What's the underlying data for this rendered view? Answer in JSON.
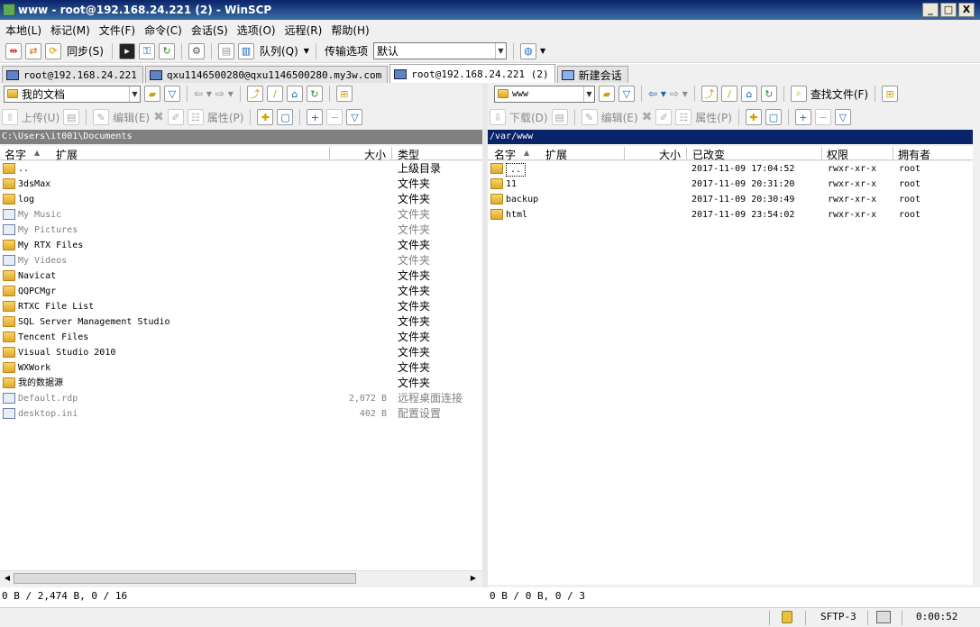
{
  "window": {
    "title": "www - root@192.168.24.221 (2) - WinSCP",
    "minimize": "_",
    "maximize": "□",
    "close": "X"
  },
  "menu": [
    "本地(L)",
    "标记(M)",
    "文件(F)",
    "命令(C)",
    "会话(S)",
    "选项(O)",
    "远程(R)",
    "帮助(H)"
  ],
  "toolbar": {
    "sync_label": "同步(S)",
    "queue_label": "队列(Q)",
    "transfer_label": "传输选项",
    "transfer_value": "默认"
  },
  "tabs": [
    {
      "label": "root@192.168.24.221"
    },
    {
      "label": "qxu1146500280@qxu1146500280.my3w.com"
    },
    {
      "label": "root@192.168.24.221 (2)"
    },
    {
      "label": "新建会话"
    }
  ],
  "left": {
    "location": "我的文档",
    "actions": {
      "upload": "上传(U)",
      "edit": "编辑(E)",
      "properties": "属性(P)"
    },
    "path": "C:\\Users\\it001\\Documents",
    "headers": {
      "name": "名字",
      "ext": "扩展",
      "size": "大小",
      "type": "类型"
    },
    "files": [
      {
        "name": "..",
        "size": "",
        "type": "上级目录",
        "kind": "up",
        "dim": false
      },
      {
        "name": "3dsMax",
        "size": "",
        "type": "文件夹",
        "kind": "folder",
        "dim": false
      },
      {
        "name": "log",
        "size": "",
        "type": "文件夹",
        "kind": "folder",
        "dim": false
      },
      {
        "name": "My Music",
        "size": "",
        "type": "文件夹",
        "kind": "special",
        "dim": true
      },
      {
        "name": "My Pictures",
        "size": "",
        "type": "文件夹",
        "kind": "special",
        "dim": true
      },
      {
        "name": "My RTX Files",
        "size": "",
        "type": "文件夹",
        "kind": "folder",
        "dim": false
      },
      {
        "name": "My Videos",
        "size": "",
        "type": "文件夹",
        "kind": "special",
        "dim": true
      },
      {
        "name": "Navicat",
        "size": "",
        "type": "文件夹",
        "kind": "folder",
        "dim": false
      },
      {
        "name": "QQPCMgr",
        "size": "",
        "type": "文件夹",
        "kind": "folder",
        "dim": false
      },
      {
        "name": "RTXC File List",
        "size": "",
        "type": "文件夹",
        "kind": "folder",
        "dim": false
      },
      {
        "name": "SQL Server Management Studio",
        "size": "",
        "type": "文件夹",
        "kind": "folder",
        "dim": false
      },
      {
        "name": "Tencent Files",
        "size": "",
        "type": "文件夹",
        "kind": "folder",
        "dim": false
      },
      {
        "name": "Visual Studio 2010",
        "size": "",
        "type": "文件夹",
        "kind": "folder",
        "dim": false
      },
      {
        "name": "WXWork",
        "size": "",
        "type": "文件夹",
        "kind": "folder",
        "dim": false
      },
      {
        "name": "我的数据源",
        "size": "",
        "type": "文件夹",
        "kind": "folder",
        "dim": false
      },
      {
        "name": "Default.rdp",
        "size": "2,072 B",
        "type": "远程桌面连接",
        "kind": "file",
        "dim": true
      },
      {
        "name": "desktop.ini",
        "size": "402 B",
        "type": "配置设置",
        "kind": "file",
        "dim": true
      }
    ],
    "status": "0 B / 2,474 B,  0 / 16"
  },
  "right": {
    "location": "www",
    "actions": {
      "download": "下载(D)",
      "edit": "编辑(E)",
      "properties": "属性(P)",
      "find": "查找文件(F)"
    },
    "path": "/var/www",
    "headers": {
      "name": "名字",
      "ext": "扩展",
      "size": "大小",
      "changed": "已改变",
      "rights": "权限",
      "owner": "拥有者"
    },
    "files": [
      {
        "name": "..",
        "changed": "2017-11-09 17:04:52",
        "rights": "rwxr-xr-x",
        "owner": "root",
        "kind": "up"
      },
      {
        "name": "11",
        "changed": "2017-11-09 20:31:20",
        "rights": "rwxr-xr-x",
        "owner": "root",
        "kind": "folder"
      },
      {
        "name": "backup",
        "changed": "2017-11-09 20:30:49",
        "rights": "rwxr-xr-x",
        "owner": "root",
        "kind": "folder"
      },
      {
        "name": "html",
        "changed": "2017-11-09 23:54:02",
        "rights": "rwxr-xr-x",
        "owner": "root",
        "kind": "folder"
      }
    ],
    "status": "0 B / 0 B,  0 / 3"
  },
  "statusbar": {
    "protocol": "SFTP-3",
    "time": "0:00:52"
  }
}
